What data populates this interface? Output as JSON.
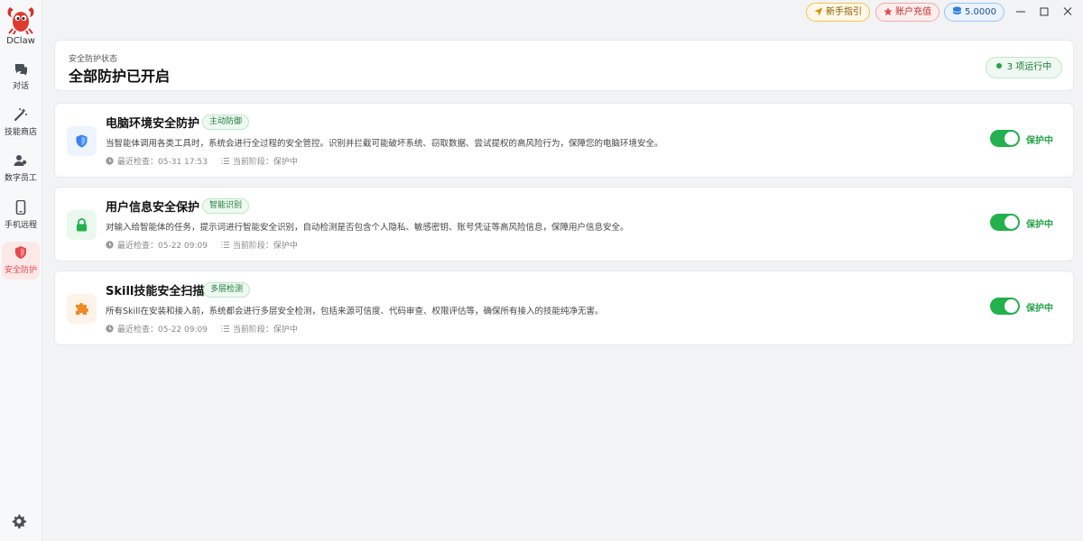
{
  "app": {
    "name": "DClaw",
    "colors": {
      "accent": "#e5484d",
      "success": "#22b14c",
      "tag_bg": "#eefaf1"
    }
  },
  "sidebar": {
    "items": [
      {
        "label": "对话",
        "icon": "chat-icon"
      },
      {
        "label": "技能商店",
        "icon": "magic-wand-icon"
      },
      {
        "label": "数字员工",
        "icon": "users-icon"
      },
      {
        "label": "手机远程",
        "icon": "phone-icon"
      },
      {
        "label": "安全防护",
        "icon": "shield-icon",
        "active": true
      }
    ],
    "settings_icon": "gear-icon"
  },
  "topbar": {
    "guide_label": "新手指引",
    "recharge_label": "账户充值",
    "balance": "5.0000"
  },
  "status": {
    "subtitle": "安全防护状态",
    "title": "全部防护已开启",
    "running": "3 项运行中"
  },
  "protections": [
    {
      "title": "电脑环境安全防护",
      "tag": "主动防御",
      "description": "当智能体调用各类工具时，系统会进行全过程的安全管控。识别并拦截可能破坏系统、窃取数据、尝试提权的高风险行为，保障您的电脑环境安全。",
      "last_check": "最近检查：05-31 17:53",
      "stage": "当前阶段：保护中",
      "status": "保护中",
      "enabled": true,
      "icon": "shield-icon",
      "icon_color": "#3b82f6",
      "icon_bg": "#eef4fe"
    },
    {
      "title": "用户信息安全保护",
      "tag": "智能识别",
      "description": "对输入给智能体的任务，提示词进行智能安全识别，自动检测是否包含个人隐私、敏感密钥、账号凭证等高风险信息，保障用户信息安全。",
      "last_check": "最近检查：05-22 09:09",
      "stage": "当前阶段：保护中",
      "status": "保护中",
      "enabled": true,
      "icon": "lock-icon",
      "icon_color": "#22b14c",
      "icon_bg": "#eaf8ee"
    },
    {
      "title": "Skill技能安全扫描",
      "tag": "多层检测",
      "description": "所有Skill在安装和接入前，系统都会进行多层安全检测，包括来源可信度、代码审查、权限评估等，确保所有接入的技能纯净无害。",
      "last_check": "最近检查：05-22 09:09",
      "stage": "当前阶段：保护中",
      "status": "保护中",
      "enabled": true,
      "icon": "puzzle-icon",
      "icon_color": "#f08a24",
      "icon_bg": "#fef3e8"
    }
  ]
}
